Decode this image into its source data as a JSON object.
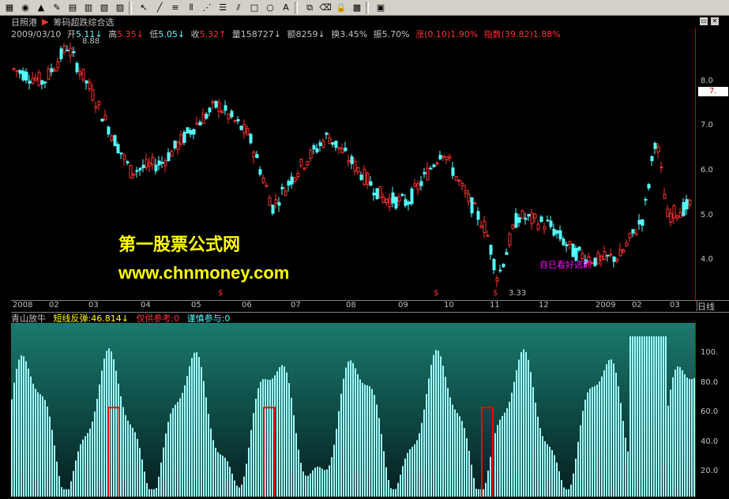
{
  "toolbar": {
    "icons": [
      "stock-icon",
      "color-icon",
      "alert-icon",
      "pencil-icon",
      "layout-icon",
      "grid-icon",
      "chart-icon",
      "picture-icon",
      "cursor-icon",
      "line-icon",
      "text-line-icon",
      "vertical-lines-icon",
      "fan-icon",
      "horizontal-lines-icon",
      "parallel-icon",
      "rectangle-icon",
      "ellipse-icon",
      "text-icon",
      "copy-icon",
      "eraser-icon",
      "lock-icon",
      "palette-icon",
      "save-icon"
    ]
  },
  "header": {
    "stock_name": "日照港",
    "selector_name": "筹码超跌综合选"
  },
  "stats": {
    "date": "2009/03/10",
    "open_label": "开",
    "open": "5.11",
    "high_label": "高",
    "high": "5.35",
    "low_label": "低",
    "low": "5.05",
    "close_label": "收",
    "close": "5.32",
    "volume_label": "量",
    "volume": "158727",
    "amount_label": "额",
    "amount": "8259",
    "turnover_label": "换",
    "turnover": "3.45%",
    "amplitude_label": "振",
    "amplitude": "5.70%",
    "change_label": "涨",
    "change": "(0.10)1.90%",
    "index_label": "指数",
    "index": "(39.82)1.88%"
  },
  "price_axis": [
    "8.0",
    "7.0",
    "6.0",
    "5.0",
    "4.0"
  ],
  "price_tag": "7.",
  "price_high_marker": "8.88",
  "price_low_marker": "3.33",
  "date_axis": [
    "2008",
    "02",
    "03",
    "04",
    "05",
    "06",
    "07",
    "08",
    "09",
    "10",
    "11",
    "12",
    "2009",
    "02",
    "03"
  ],
  "corner_label": "日线",
  "watermark": {
    "line1": "第一股票公式网",
    "line2": "www.chnmoney.com"
  },
  "annotation": "自已看好选的",
  "indicator": {
    "name": "青山放牛",
    "line1_label": "短线反弹:",
    "line1_value": "46.814",
    "line2_label": "仅供参考:",
    "line2_value": "0",
    "line3_label": "谨慎参与:",
    "line3_value": "0"
  },
  "indicator_axis": [
    "100.",
    "80.0",
    "60.0",
    "40.0",
    "20.0"
  ],
  "colors": {
    "up": "#ff3030",
    "down": "#54ffff",
    "title_yellow": "#ffff00",
    "indicator_bar": "#a0ffff"
  },
  "dollar_marks": [
    "$",
    "$",
    "$"
  ]
}
